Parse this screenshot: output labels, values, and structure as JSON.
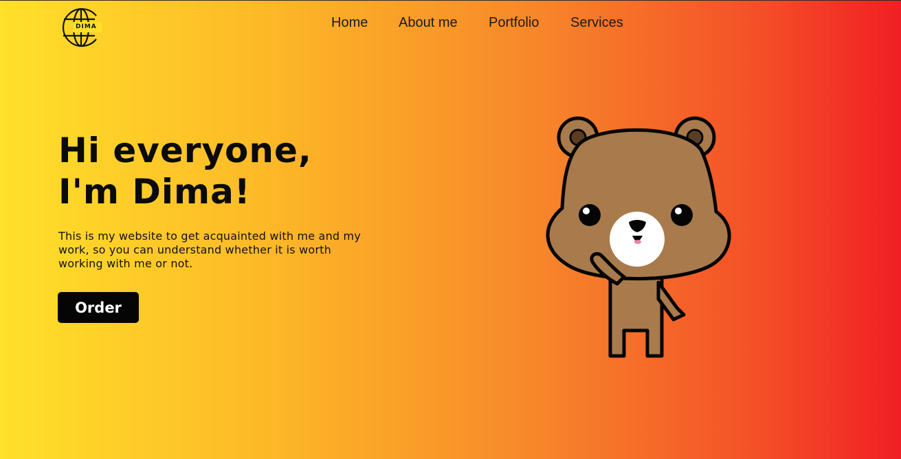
{
  "logo": {
    "text": "DIMA",
    "icon": "globe-logo-icon"
  },
  "nav": {
    "items": [
      {
        "label": "Home"
      },
      {
        "label": "About me"
      },
      {
        "label": "Portfolio"
      },
      {
        "label": "Services"
      }
    ]
  },
  "hero": {
    "title_line1": "Hi everyone,",
    "title_line2": "I'm Dima!",
    "description": "This is my website to get acquainted with me and my work, so you can understand whether it is worth working with me or not.",
    "button_label": "Order",
    "illustration": "bear-mascot-illustration"
  },
  "colors": {
    "gradient_start": "#ffe02a",
    "gradient_end": "#f01f24",
    "button_bg": "#050505",
    "bear_fur": "#a87a4c"
  }
}
